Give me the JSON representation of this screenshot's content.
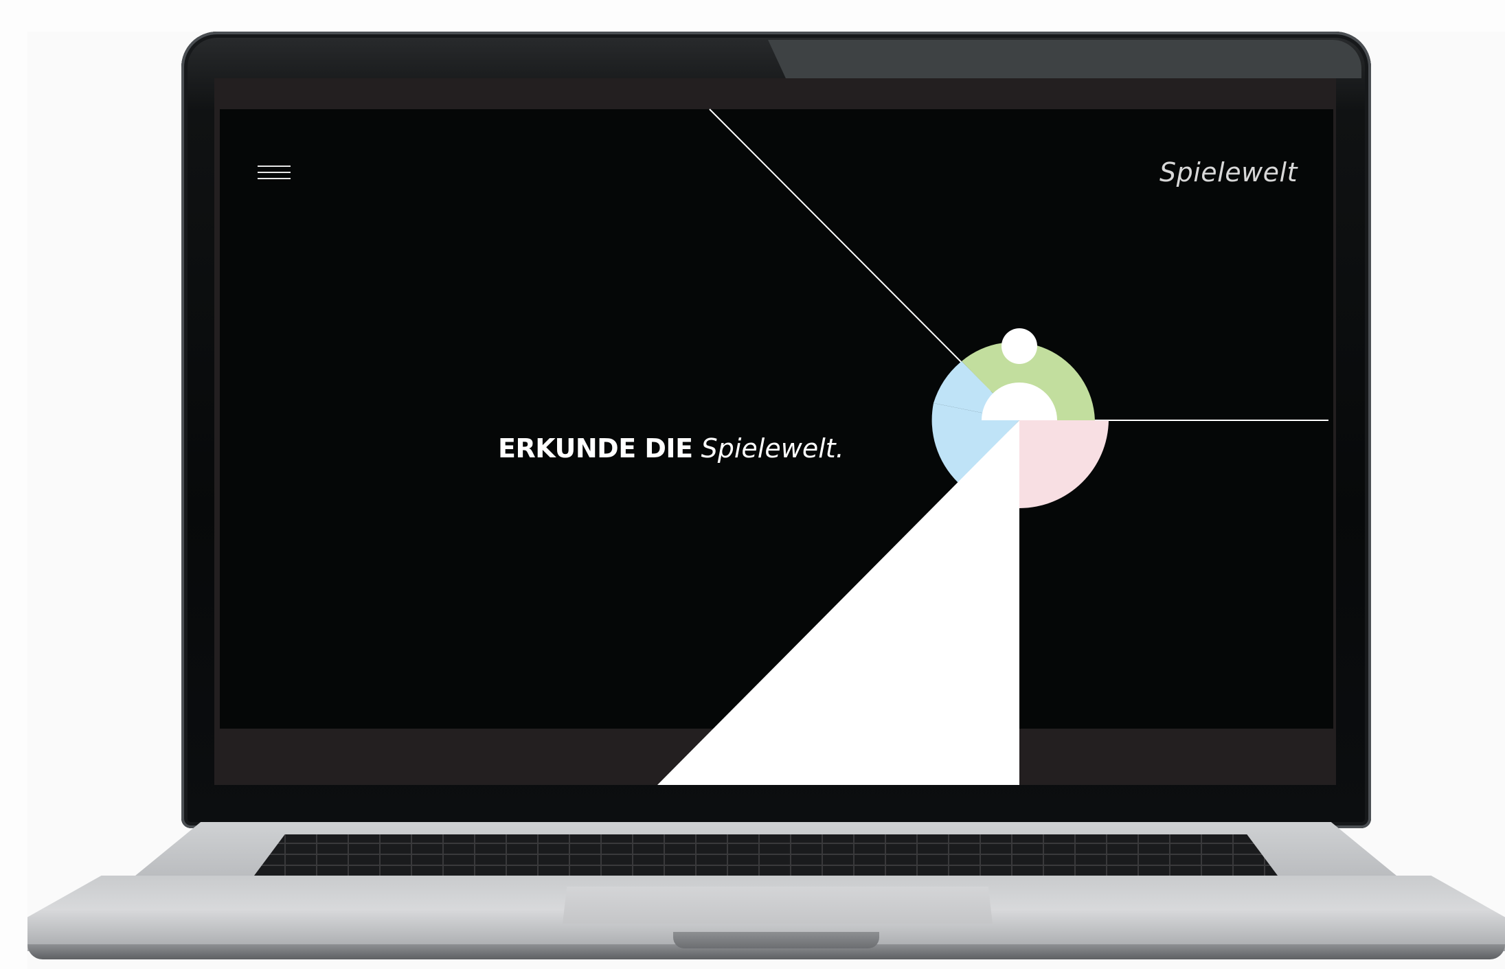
{
  "site": {
    "brand": "Spielewelt",
    "menu_icon": "hamburger-menu-icon"
  },
  "hero": {
    "headline_bold": "ERKUNDE DIE",
    "headline_italic": "Spielewelt",
    "headline_end": "."
  },
  "colors": {
    "background": "#050707",
    "frame": "#231f20",
    "blue": "#bfe3f7",
    "green": "#c2de9e",
    "pink": "#f8dfe3",
    "white": "#ffffff"
  }
}
